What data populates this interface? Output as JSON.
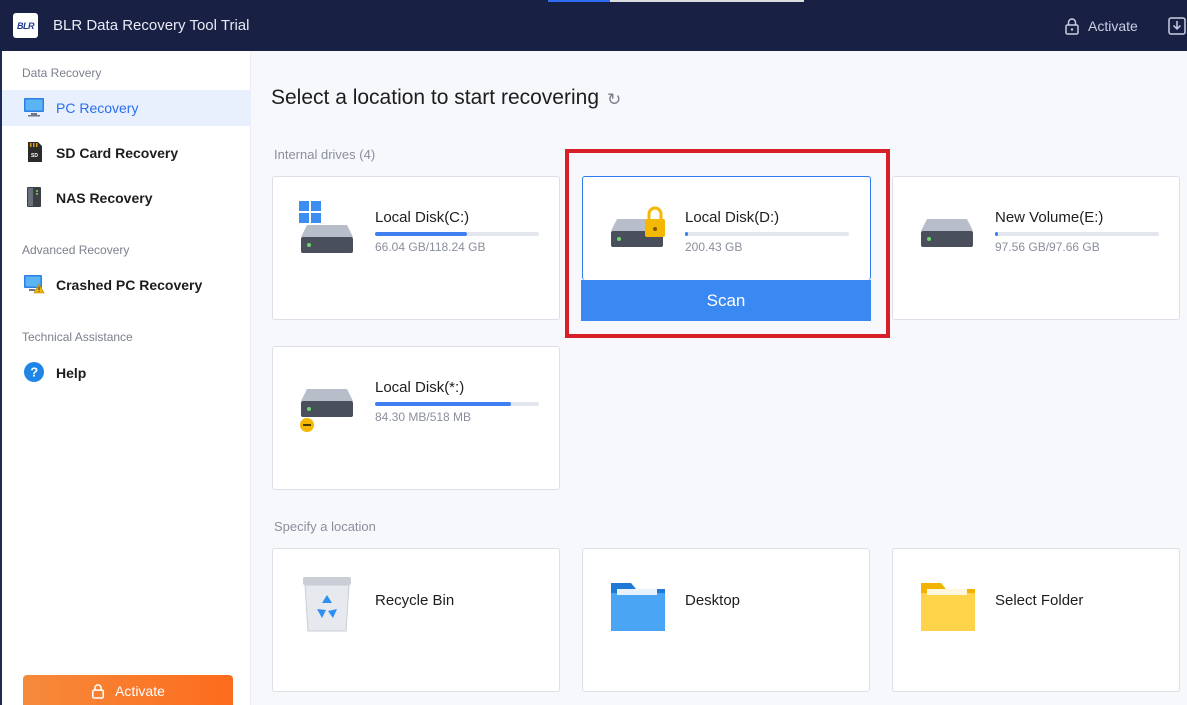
{
  "app": {
    "logo_text": "BLR",
    "title": "BLR Data Recovery Tool Trial",
    "activate_label": "Activate"
  },
  "sidebar": {
    "sections": [
      {
        "label": "Data Recovery"
      },
      {
        "label": "Advanced Recovery"
      },
      {
        "label": "Technical Assistance"
      }
    ],
    "items": [
      {
        "label": "PC Recovery",
        "icon": "monitor-icon",
        "active": true
      },
      {
        "label": "SD Card Recovery",
        "icon": "sd-card-icon"
      },
      {
        "label": "NAS Recovery",
        "icon": "nas-icon"
      },
      {
        "label": "Crashed PC Recovery",
        "icon": "crashed-pc-icon"
      },
      {
        "label": "Help",
        "icon": "help-icon"
      }
    ],
    "activate_label": "Activate"
  },
  "main": {
    "heading": "Select a location to start recovering",
    "internal_label": "Internal drives (4)",
    "drives": [
      {
        "name": "Local Disk(C:)",
        "size": "66.04 GB/118.24 GB",
        "used_fraction": 0.56
      },
      {
        "name": "Local Disk(D:)",
        "size": "200.43 GB",
        "used_fraction": 0.02,
        "locked": true,
        "selected": true
      },
      {
        "name": "New Volume(E:)",
        "size": "97.56 GB/97.66 GB",
        "used_fraction": 0.02
      },
      {
        "name": "Local Disk(*:)",
        "size": "84.30 MB/518 MB",
        "used_fraction": 0.83
      }
    ],
    "scan_label": "Scan",
    "specify_label": "Specify a location",
    "locations": [
      {
        "name": "Recycle Bin"
      },
      {
        "name": "Desktop"
      },
      {
        "name": "Select Folder"
      }
    ]
  },
  "colors": {
    "titlebar": "#182044",
    "accent": "#3a88f2",
    "highlight": "#d61f26",
    "activate": "#fc6c1c"
  }
}
